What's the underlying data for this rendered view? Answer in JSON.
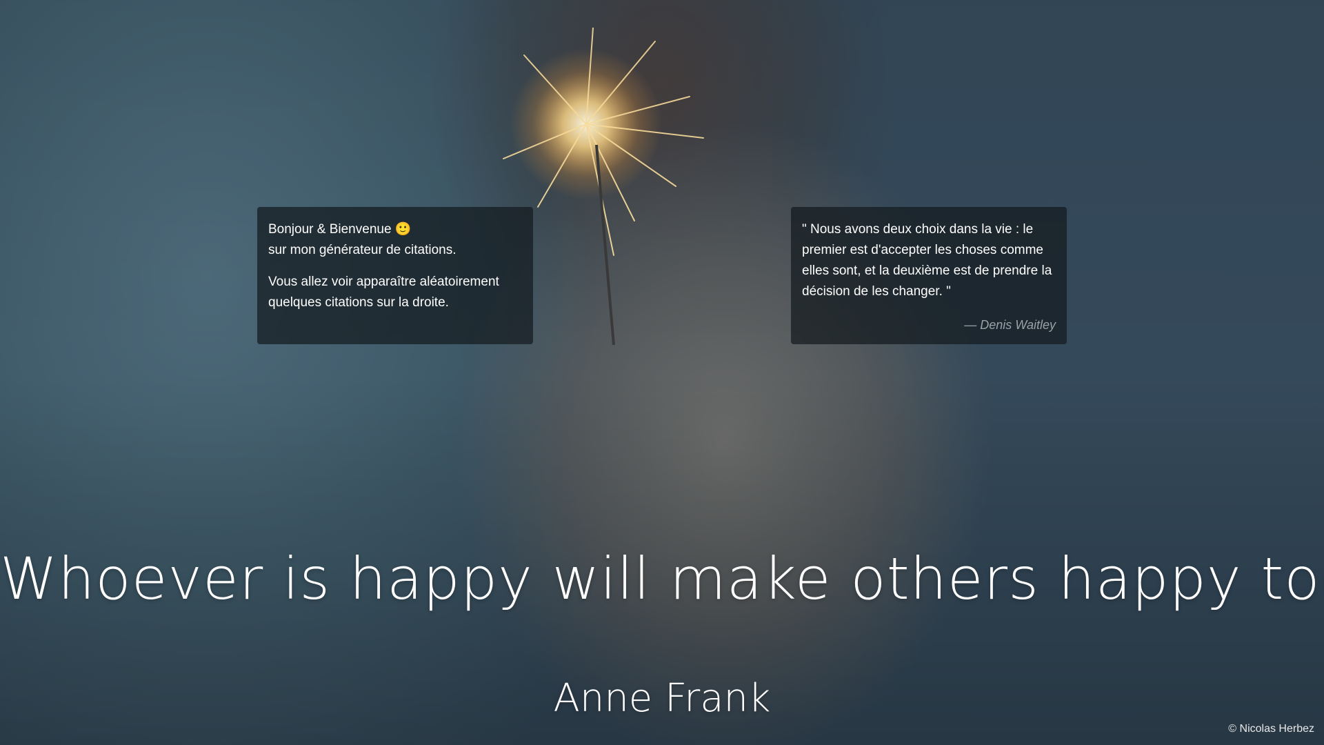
{
  "welcome_card": {
    "line1": "Bonjour & Bienvenue",
    "emoji": "🙂",
    "line2": "sur mon générateur de citations.",
    "paragraph2": "Vous allez voir apparaître aléatoirement quelques citations sur la droite."
  },
  "quote_card": {
    "text": "\" Nous avons deux choix dans la vie : le premier est d'accepter les choses comme elles sont, et la deuxième est de prendre la décision de les changer. \"",
    "author": "— Denis Waitley"
  },
  "main_quote": {
    "text": "Whoever is happy will make others happy too.",
    "author": "Anne Frank"
  },
  "footer": {
    "copyright": "© Nicolas Herbez"
  },
  "colors": {
    "card_background": "#141a1e",
    "muted_author": "#9aa2a8"
  }
}
